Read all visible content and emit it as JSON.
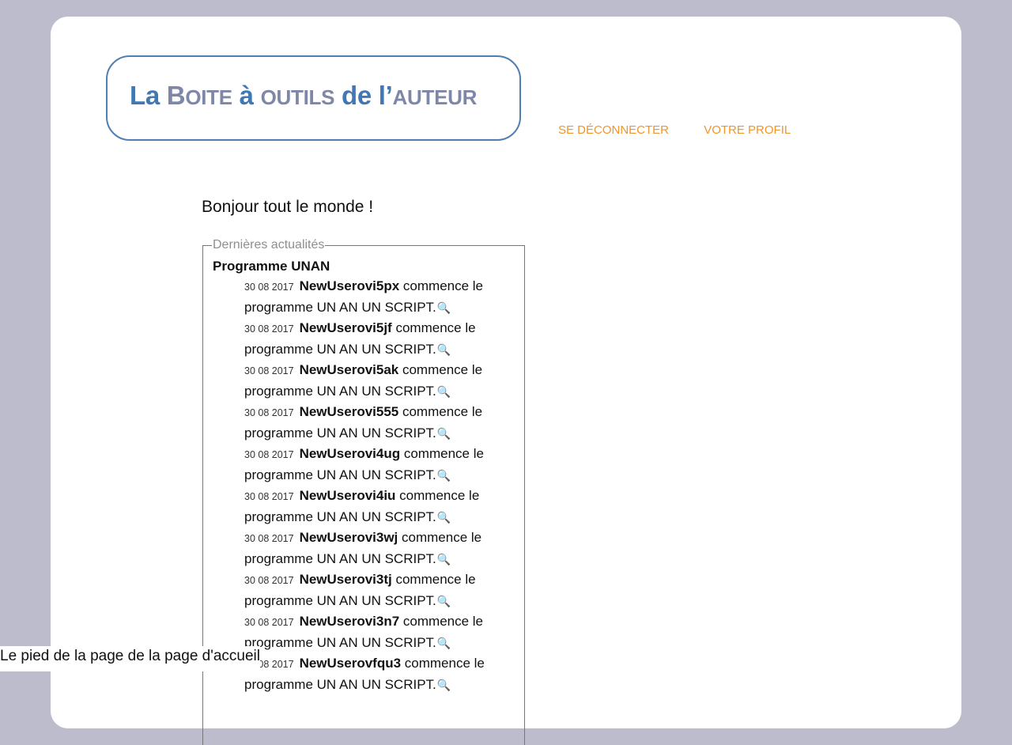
{
  "logo": {
    "part1": "La ",
    "part2_initial": "B",
    "part2_rest": "oite",
    "part3": " à ",
    "part4": "outils",
    "part5": " de l’",
    "part6": "auteur"
  },
  "nav": {
    "logout": "SE DÉCONNECTER",
    "profile": "VOTRE PROFIL"
  },
  "greeting": "Bonjour tout le monde !",
  "news": {
    "legend": "Dernières actualités",
    "program_title": "Programme UNAN",
    "items": [
      {
        "date": "30 08 2017",
        "user": "NewUserovi5px",
        "text": " commence le programme UN AN UN SCRIPT.",
        "icon": "🔍"
      },
      {
        "date": "30 08 2017",
        "user": "NewUserovi5jf",
        "text": " commence le programme UN AN UN SCRIPT.",
        "icon": "🔍"
      },
      {
        "date": "30 08 2017",
        "user": "NewUserovi5ak",
        "text": " commence le programme UN AN UN SCRIPT.",
        "icon": "🔍"
      },
      {
        "date": "30 08 2017",
        "user": "NewUserovi555",
        "text": " commence le programme UN AN UN SCRIPT.",
        "icon": "🔍"
      },
      {
        "date": "30 08 2017",
        "user": "NewUserovi4ug",
        "text": " commence le programme UN AN UN SCRIPT.",
        "icon": "🔍"
      },
      {
        "date": "30 08 2017",
        "user": "NewUserovi4iu",
        "text": " commence le programme UN AN UN SCRIPT.",
        "icon": "🔍"
      },
      {
        "date": "30 08 2017",
        "user": "NewUserovi3wj",
        "text": " commence le programme UN AN UN SCRIPT.",
        "icon": "🔍"
      },
      {
        "date": "30 08 2017",
        "user": "NewUserovi3tj",
        "text": " commence le programme UN AN UN SCRIPT.",
        "icon": "🔍"
      },
      {
        "date": "30 08 2017",
        "user": "NewUserovi3n7",
        "text": " commence le programme UN AN UN SCRIPT.",
        "icon": "🔍"
      },
      {
        "date": "30 08 2017",
        "user": "NewUserovfqu3",
        "text": " commence le programme UN AN UN SCRIPT.",
        "icon": "🔍"
      }
    ]
  },
  "footer": "Le pied de la page de la page d'accueil"
}
